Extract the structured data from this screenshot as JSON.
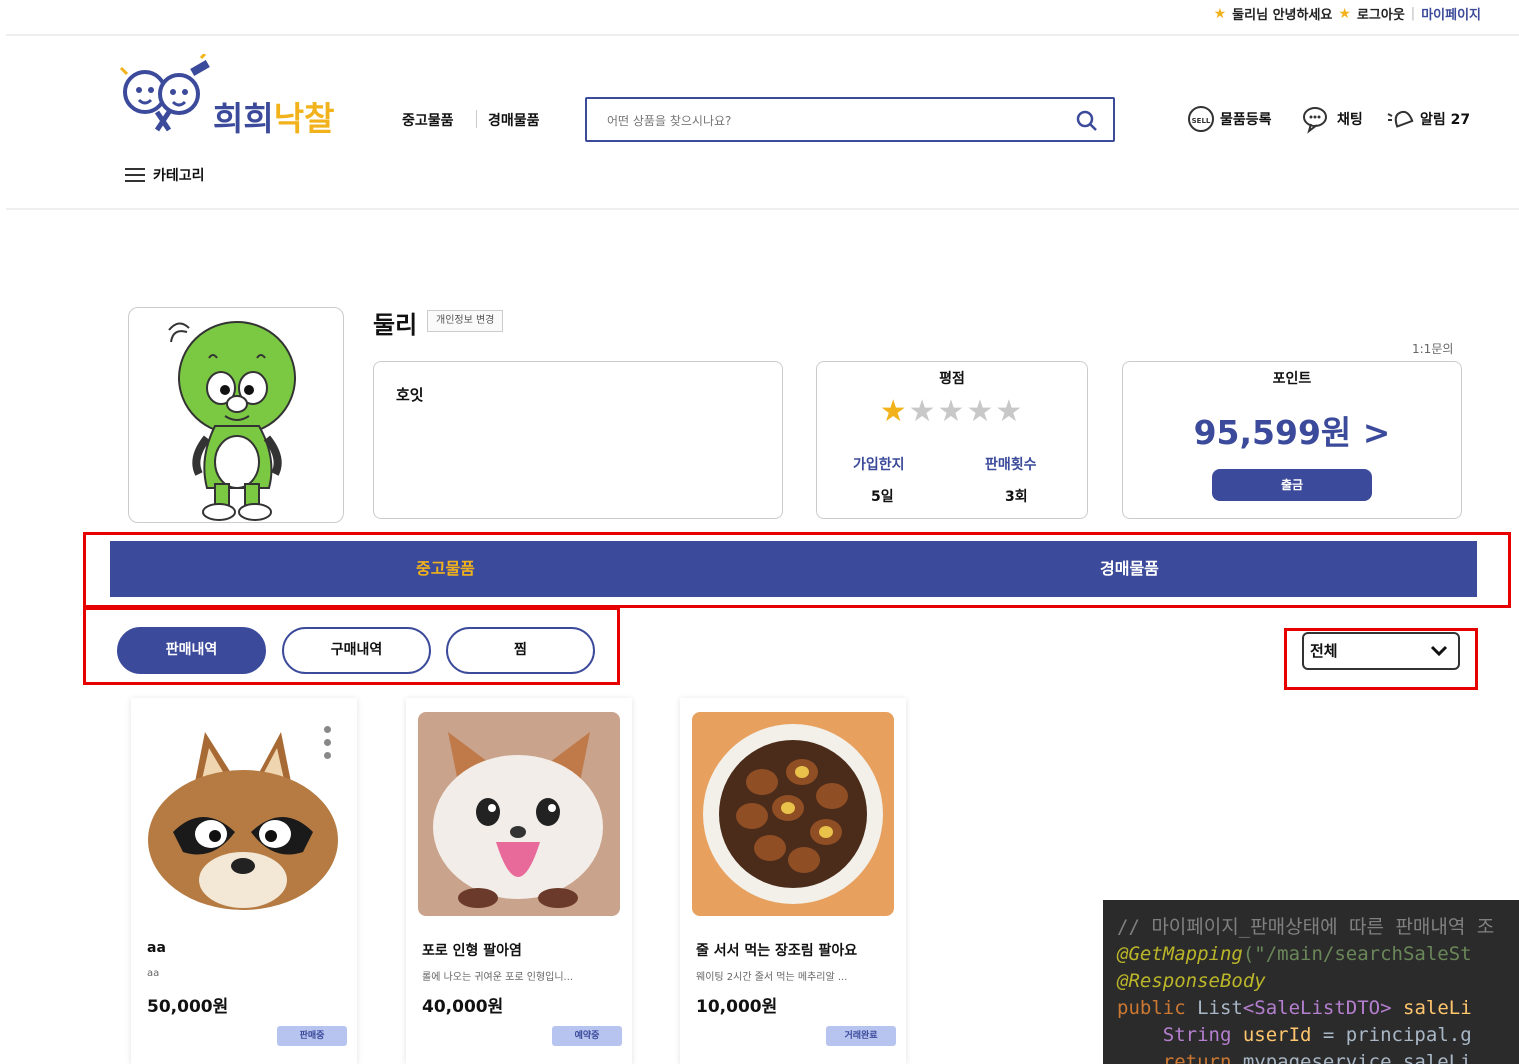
{
  "top_util": {
    "greeting": "둘리님 안녕하세요",
    "logout": "로그아웃",
    "mypage": "마이페이지"
  },
  "header": {
    "logo_text_1": "희희",
    "logo_text_2": "낙찰",
    "nav": [
      "중고물품",
      "경매물품"
    ],
    "search_placeholder": "어떤 상품을 찾으시나요?",
    "register": "물품등록",
    "chat": "채팅",
    "alarm": "알림 27",
    "category": "카테고리"
  },
  "profile": {
    "name": "둘리",
    "edit_label": "개인정보 변경",
    "inquiry": "1:1문의",
    "intro": "호잇",
    "rating_title": "평점",
    "rating_stars": 1,
    "rating_max": 5,
    "join_label": "가입한지",
    "join_value": "5일",
    "sales_label": "판매횟수",
    "sales_value": "3회",
    "point_title": "포인트",
    "point_value": "95,599원 >",
    "withdraw_label": "출금"
  },
  "main_tabs": [
    "중고물품",
    "경매물품"
  ],
  "sub_tabs": [
    "판매내역",
    "구매내역",
    "찜"
  ],
  "filter": {
    "selected": "전체"
  },
  "products": [
    {
      "title": "aa",
      "desc": "aa",
      "price": "50,000원",
      "status": "판매중"
    },
    {
      "title": "포로 인형 팔아염",
      "desc": "롤에 나오는 귀여운 포로 인형입니...",
      "price": "40,000원",
      "status": "예약중"
    },
    {
      "title": "줄 서서 먹는 장조림 팔아요",
      "desc": "웨이팅 2시간 줄서 먹는 메추리알 ...",
      "price": "10,000원",
      "status": "거래완료"
    }
  ],
  "code": {
    "line1": "// 마이페이지_판매상태에 따른 판매내역 조",
    "line2_ann": "@GetMapping",
    "line2_str": "(\"/main/searchSaleSt",
    "line3": "@ResponseBody",
    "line4_kw": "public ",
    "line4_type": "List",
    "line4_gen": "<SaleListDTO>",
    "line4_rest": " saleLi",
    "line5_type": "String ",
    "line5_var": "userId",
    "line5_rest": " = principal.g",
    "line6_kw": "return ",
    "line6_rest": "mypageservice.saleLi"
  }
}
